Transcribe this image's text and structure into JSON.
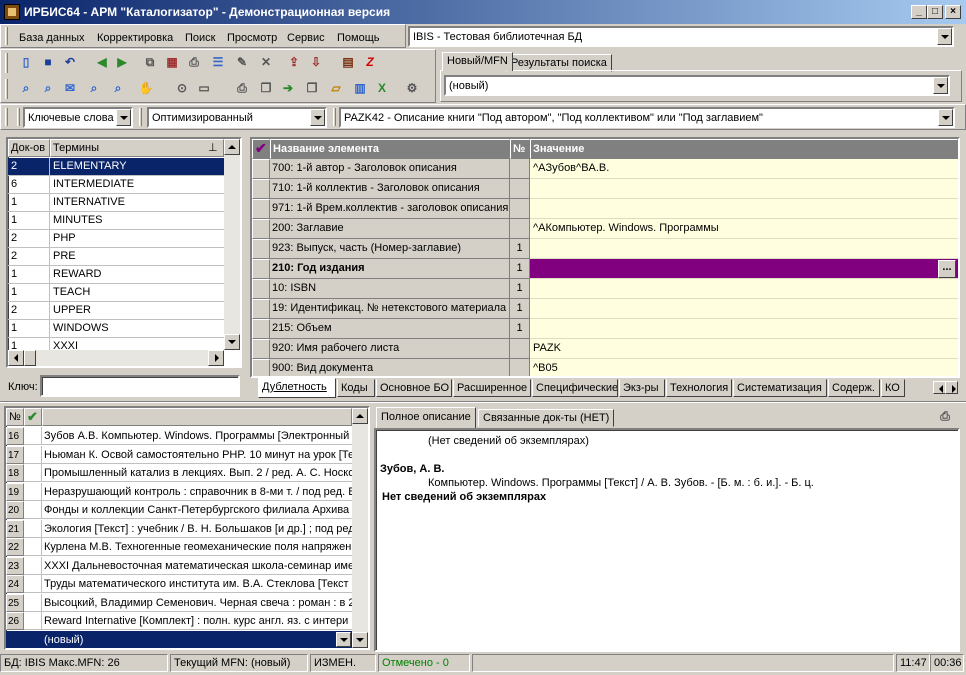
{
  "window": {
    "title": "ИРБИС64 - АРМ \"Каталогизатор\" - Демонстрационная версия",
    "min": "_",
    "max": "□",
    "close": "×"
  },
  "menu": [
    "База данных",
    "Корректировка",
    "Поиск",
    "Просмотр",
    "Сервис",
    "Помощь"
  ],
  "db_combo": "IBIS - Тестовая библиотечная БД",
  "top_tabs": [
    "Новый/MFN",
    "Результаты поиска"
  ],
  "new_combo": "(новый)",
  "search_mode": "Ключевые слова",
  "optimize_combo": "Оптимизированный",
  "worksheet_combo": "PAZK42 - Описание книги \"Под автором\", \"Под коллективом\" или \"Под заглавием\"",
  "dict": {
    "col_count": "Док-ов",
    "col_term": "Термины",
    "rows": [
      [
        "2",
        "ELEMENTARY"
      ],
      [
        "6",
        "INTERMEDIATE"
      ],
      [
        "1",
        "INTERNATIVE"
      ],
      [
        "1",
        "MINUTES"
      ],
      [
        "2",
        "PHP"
      ],
      [
        "2",
        "PRE"
      ],
      [
        "1",
        "REWARD"
      ],
      [
        "1",
        "TEACH"
      ],
      [
        "2",
        "UPPER"
      ],
      [
        "1",
        "WINDOWS"
      ],
      [
        "1",
        "XXXI"
      ]
    ],
    "key_label": "Ключ:"
  },
  "fields": {
    "col_name": "Название элемента",
    "col_num": "№",
    "col_value": "Значение",
    "rows": [
      [
        "700: 1-й автор - Заголовок описания",
        "",
        "^AЗубов^BА.В."
      ],
      [
        "710: 1-й коллектив - Заголовок описания",
        "",
        ""
      ],
      [
        "971: 1-й Врем.коллектив - заголовок описания",
        "",
        ""
      ],
      [
        "200: Заглавие",
        "",
        "^AКомпьютер. Windows. Программы"
      ],
      [
        "923: Выпуск, часть (Номер-заглавие)",
        "1",
        ""
      ],
      [
        "210: Год издания",
        "1",
        ""
      ],
      [
        "10: ISBN",
        "1",
        ""
      ],
      [
        "19: Идентификац. № нетекстового материала",
        "1",
        ""
      ],
      [
        "215: Объем",
        "1",
        ""
      ],
      [
        "920: Имя рабочего листа",
        "",
        "PAZK"
      ],
      [
        "900: Вид документа",
        "",
        "^B05"
      ]
    ],
    "ellipsis": "..."
  },
  "field_tabs": [
    "Дублетность",
    "Коды",
    "Основное БО",
    "Расширенное",
    "Специфические",
    "Экз-ры",
    "Технология",
    "Систематизация",
    "Содерж.",
    "КО"
  ],
  "records": {
    "col_num": "№",
    "rows": [
      [
        "16",
        "Зубов А.В. Компьютер. Windows. Программы [Электронный"
      ],
      [
        "17",
        "Ньюман К. Освой самостоятельно PHP. 10 минут на урок [Те"
      ],
      [
        "18",
        "Промышленный катализ в лекциях. Вып. 2 / ред. А. С. Носко"
      ],
      [
        "19",
        "Неразрушающий контроль : справочник в 8-ми т. / под ред. В"
      ],
      [
        "20",
        "Фонды и коллекции Санкт-Петербургского филиала Архива Р"
      ],
      [
        "21",
        "Экология [Текст] : учебник / В. Н. Большаков [и др.] ; под ред"
      ],
      [
        "22",
        "Курлена М.В. Техногенные геомеханические поля напряжени"
      ],
      [
        "23",
        "XXXI Дальневосточная математическая школа-семинар име"
      ],
      [
        "24",
        "Труды математического института им. В.А. Стеклова [Текст"
      ],
      [
        "25",
        "Высоцкий, Владимир Семенович. Черная свеча : роман : в 2"
      ],
      [
        "26",
        "Reward Internative [Комплект] : полн. курс англ. яз. с интери"
      ]
    ],
    "new_row": "(новый)"
  },
  "desc_tabs": [
    "Полное описание",
    "Связанные док-ты (НЕТ)"
  ],
  "description": {
    "line1": "(Нет сведений об экземплярах)",
    "author": "Зубов, А. В.",
    "body": "Компьютер. Windows. Программы [Текст] / А. В. Зубов. - [Б. м. : б. и.]. - Б. ц.",
    "bold": "Нет сведений об экземплярах"
  },
  "status": {
    "db": "БД: IBIS Макс.MFN: 26",
    "mfn": "Текущий MFN: (новый)",
    "changed": "ИЗМЕН.",
    "marked": "Отмечено - 0",
    "time": "11:47",
    "timer": "00:36"
  },
  "colors": {
    "selected": "#0a246a",
    "field_value_bg": "#ffffe0",
    "current_row": "#800080",
    "marked_text": "#008000"
  }
}
